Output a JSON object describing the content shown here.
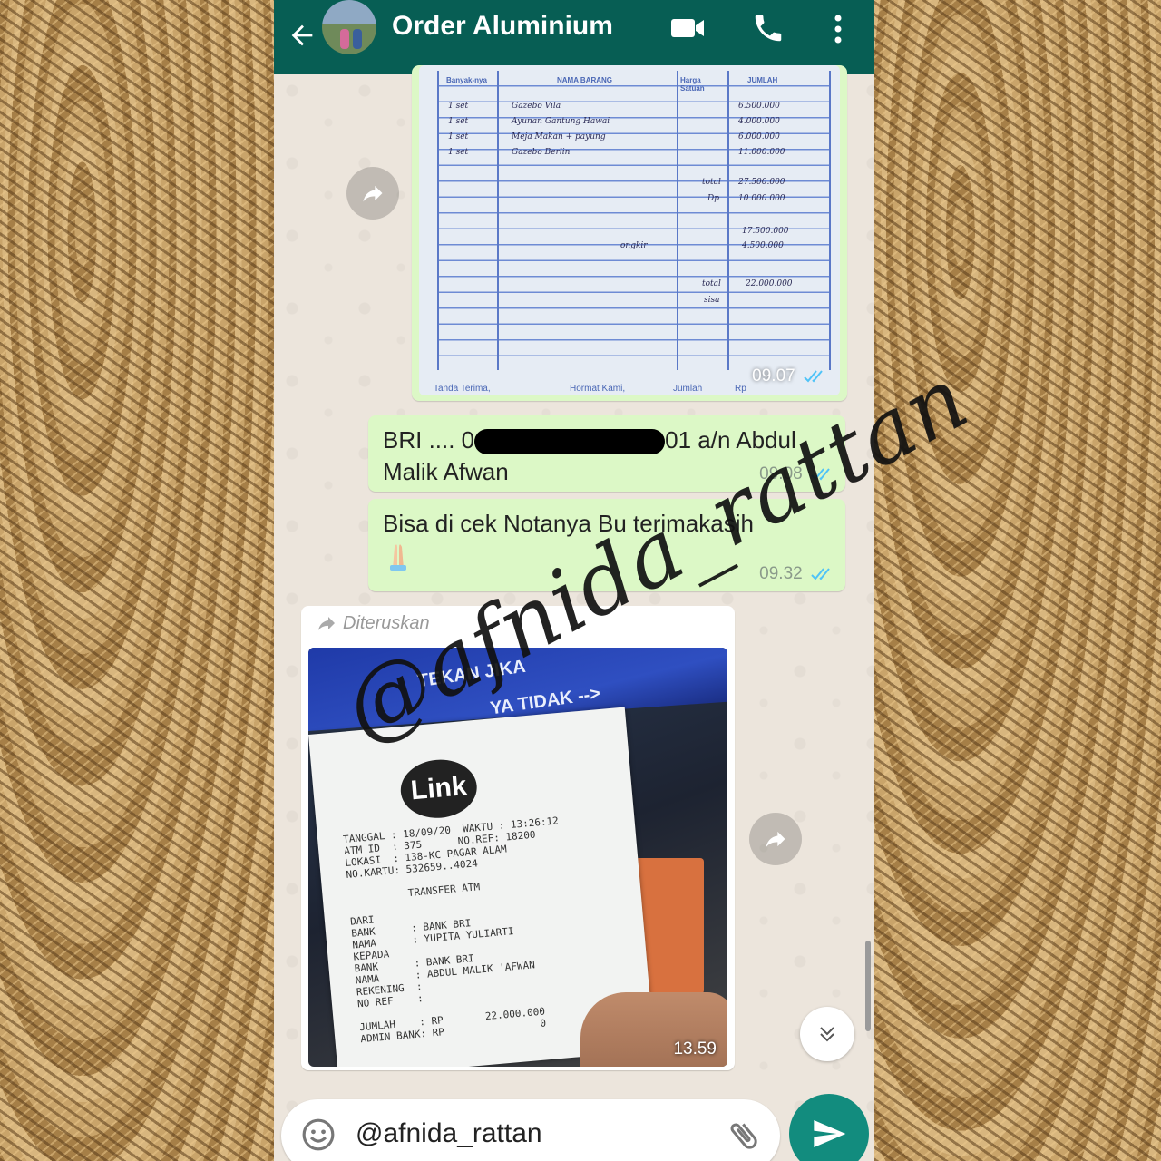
{
  "header": {
    "title": "Order Aluminium"
  },
  "messages": {
    "invoice_photo": {
      "time": "09.07",
      "headers": {
        "qty": "Banyak-nya",
        "item": "NAMA BARANG",
        "price": "Harga Satuan",
        "amount": "JUMLAH"
      },
      "rows": [
        {
          "qty": "1 set",
          "item": "Gazebo Vila",
          "amount": "6.500.000"
        },
        {
          "qty": "1 set",
          "item": "Ayunan Gantung Hawai",
          "amount": "4.000.000"
        },
        {
          "qty": "1 set",
          "item": "Meja Makan + payung",
          "amount": "6.000.000"
        },
        {
          "qty": "1 set",
          "item": "Gazebo Berlin",
          "amount": "11.000.000"
        }
      ],
      "total_label": "total",
      "total_value": "27.500.000",
      "dp_label": "Dp",
      "dp_value": "10.000.000",
      "sub1": "17.500.000",
      "ongkir_label": "ongkir",
      "ongkir_value": "4.500.000",
      "total2_label": "total",
      "sisa_label": "sisa",
      "total2_value": "22.000.000",
      "footer_left": "Tanda Terima,",
      "footer_mid": "Hormat Kami,",
      "footer_right": "Jumlah",
      "footer_rp": "Rp"
    },
    "bank_text": {
      "prefix": "BRI .... 0",
      "suffix": "01 a/n Abdul Malik Afwan",
      "time": "09.08"
    },
    "thanks_text": {
      "text": "Bisa di cek Notanya Bu terimakasih",
      "time": "09.32"
    },
    "forwarded_photo": {
      "forward_label": "Diteruskan",
      "atm_text_1": "TEKAN JIKA",
      "atm_text_2": "YA TIDAK -->",
      "logo": "Link",
      "receipt_lines": "TANGGAL : 18/09/20  WAKTU : 13:26:12\nATM ID  : 375      NO.REF: 18200\nLOKASI  : 138-KC PAGAR ALAM\nNO.KARTU: 532659..4024\n\n          TRANSFER ATM\n\nDARI\nBANK      : BANK BRI\nNAMA      : YUPITA YULIARTI\nKEPADA\nBANK      : BANK BRI\nNAMA      : ABDUL MALIK 'AFWAN\nREKENING  :\nNO REF    :\n\nJUMLAH    : RP       22.000.000\nADMIN BANK: RP                0",
      "time": "13.59"
    }
  },
  "input": {
    "value": "@afnida_rattan"
  },
  "watermark": "@afnida_rattan",
  "colors": {
    "header": "#075e54",
    "outgoing_bubble": "#dcf8c6",
    "read_ticks": "#4fc3f7",
    "send_button": "#128c7e"
  },
  "icons": [
    "back-arrow-icon",
    "video-call-icon",
    "phone-icon",
    "menu-dots-icon",
    "forward-icon",
    "scroll-down-icon",
    "emoji-icon",
    "attach-icon",
    "send-icon"
  ]
}
